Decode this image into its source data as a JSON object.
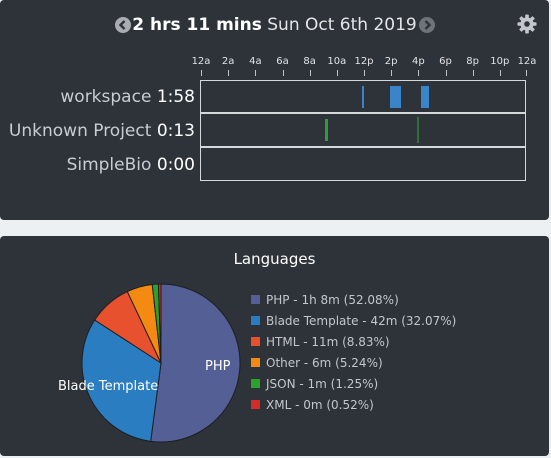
{
  "header": {
    "duration": "2 hrs 11 mins",
    "date": "Sun Oct 6th 2019"
  },
  "icons": {
    "prev": "chevron-left-circle-icon",
    "next": "chevron-right-circle-icon",
    "settings": "gear-icon"
  },
  "timeline": {
    "hour_labels": [
      "12a",
      "2a",
      "4a",
      "6a",
      "8a",
      "10a",
      "12p",
      "2p",
      "4p",
      "6p",
      "8p",
      "10p",
      "12a"
    ],
    "projects": [
      {
        "name": "workspace",
        "time": "1:58",
        "color": "#3a84c9",
        "segments": [
          {
            "start_hour": 11.9,
            "end_hour": 12.1
          },
          {
            "start_hour": 14.0,
            "end_hour": 14.8
          },
          {
            "start_hour": 16.3,
            "end_hour": 16.9
          }
        ]
      },
      {
        "name": "Unknown Project",
        "time": "0:13",
        "color": "#2f9d3a",
        "segments": [
          {
            "start_hour": 9.2,
            "end_hour": 9.4
          },
          {
            "start_hour": 16.0,
            "end_hour": 16.05
          }
        ]
      },
      {
        "name": "SimpleBio",
        "time": "0:00",
        "color": "#d43636",
        "segments": []
      }
    ]
  },
  "languages": {
    "title": "Languages",
    "slices": [
      {
        "name": "PHP",
        "legend": "PHP - 1h 8m (52.08%)",
        "percent": 52.08,
        "color": "#535f95",
        "pie_label": "PHP"
      },
      {
        "name": "Blade Template",
        "legend": "Blade Template - 42m (32.07%)",
        "percent": 32.07,
        "color": "#2a7dc1",
        "pie_label": "Blade Template"
      },
      {
        "name": "HTML",
        "legend": "HTML - 11m (8.83%)",
        "percent": 8.83,
        "color": "#e8512d",
        "pie_label": ""
      },
      {
        "name": "Other",
        "legend": "Other - 6m (5.24%)",
        "percent": 5.24,
        "color": "#f58a12",
        "pie_label": ""
      },
      {
        "name": "JSON",
        "legend": "JSON - 1m (1.25%)",
        "percent": 1.25,
        "color": "#2ca12b",
        "pie_label": ""
      },
      {
        "name": "XML",
        "legend": "XML - 0m (0.52%)",
        "percent": 0.52,
        "color": "#d42b2b",
        "pie_label": ""
      }
    ]
  },
  "chart_data": {
    "type": "pie",
    "title": "Languages",
    "categories": [
      "PHP",
      "Blade Template",
      "HTML",
      "Other",
      "JSON",
      "XML"
    ],
    "values": [
      52.08,
      32.07,
      8.83,
      5.24,
      1.25,
      0.52
    ]
  }
}
